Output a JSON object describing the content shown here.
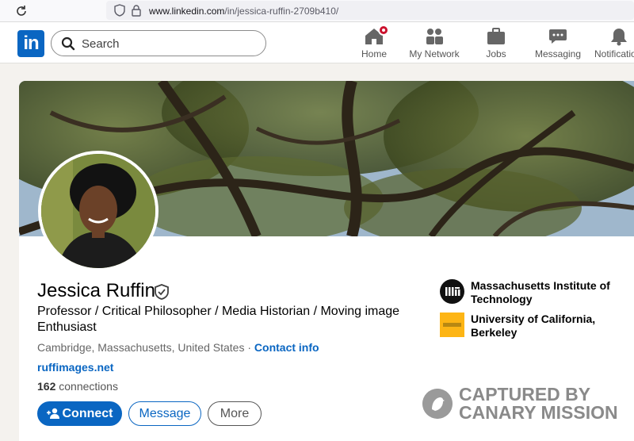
{
  "browser": {
    "url_host": "www.linkedin.com",
    "url_path": "/in/jessica-ruffin-2709b410/"
  },
  "nav": {
    "logo": "in",
    "search_placeholder": "Search",
    "items": [
      {
        "label": "Home",
        "icon": "home-icon"
      },
      {
        "label": "My Network",
        "icon": "people-icon"
      },
      {
        "label": "Jobs",
        "icon": "briefcase-icon"
      },
      {
        "label": "Messaging",
        "icon": "chat-icon"
      },
      {
        "label": "Notifications",
        "icon": "bell-icon"
      }
    ]
  },
  "profile": {
    "name": "Jessica Ruffin",
    "headline": "Professor / Critical Philosopher / Media Historian / Moving image Enthusiast",
    "location": "Cambridge, Massachusetts, United States",
    "location_sep": " · ",
    "contact_label": "Contact info",
    "website": "ruffimages.net",
    "connections_count": "162",
    "connections_label": "connections",
    "buttons": {
      "connect": "Connect",
      "message": "Message",
      "more": "More"
    },
    "orgs": [
      {
        "name": "Massachusetts Institute of Technology",
        "logo_text": "MIT"
      },
      {
        "name": "University of California, Berkeley",
        "logo_text": "UC Berkeley"
      }
    ]
  },
  "watermark": {
    "line1": "CAPTURED BY",
    "line2": "CANARY MISSION"
  },
  "colors": {
    "linkedin_blue": "#0a66c2",
    "badge_red": "#cb112d",
    "berkeley_gold": "#fdb515"
  }
}
